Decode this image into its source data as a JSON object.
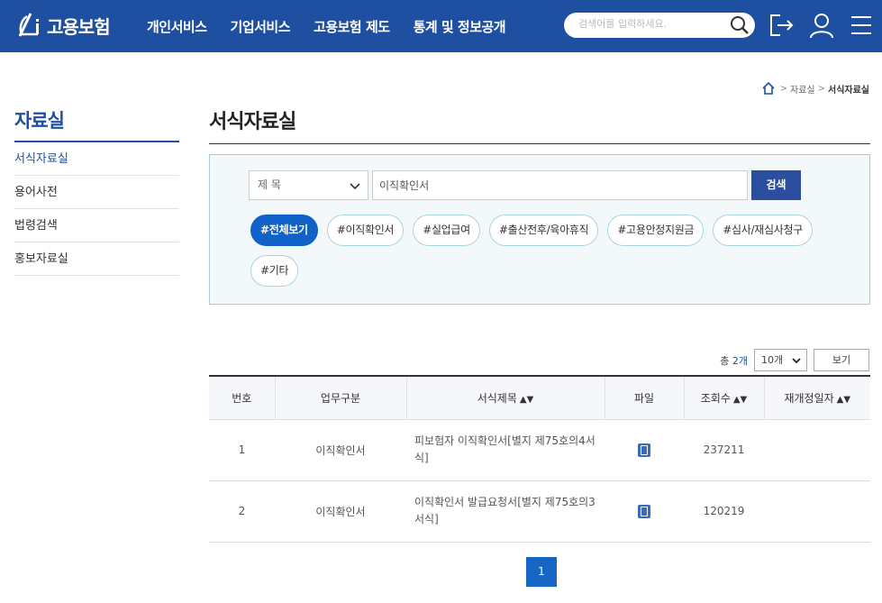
{
  "header": {
    "logo_mark": "ei",
    "logo_text": "고용보험",
    "nav": [
      "개인서비스",
      "기업서비스",
      "고용보험 제도",
      "통계 및 정보공개"
    ],
    "search_placeholder": "검색어를 입력하세요."
  },
  "breadcrumb": {
    "items": [
      "자료실",
      "서식자료실"
    ]
  },
  "sidebar": {
    "title": "자료실",
    "items": [
      {
        "label": "서식자료실",
        "active": true
      },
      {
        "label": "용어사전"
      },
      {
        "label": "법령검색"
      },
      {
        "label": "홍보자료실"
      }
    ]
  },
  "page_title": "서식자료실",
  "filter": {
    "select_value": "제 목",
    "keyword": "이직확인서",
    "search_label": "검색",
    "tags": [
      "#전체보기",
      "#이직확인서",
      "#실업급여",
      "#출산전후/육아휴직",
      "#고용안정지원금",
      "#심사/재심사청구",
      "#기타"
    ]
  },
  "list_info": {
    "total_prefix": "총",
    "total_count": "2개",
    "page_size": "10개",
    "view_label": "보기"
  },
  "table": {
    "headers": [
      "번호",
      "업무구분",
      "서식제목",
      "파일",
      "조회수",
      "재개정일자"
    ],
    "sort_glyph": "▲▼",
    "rows": [
      {
        "no": "1",
        "category": "이직확인서",
        "title": "피보험자 이직확인서[별지 제75호의4서식]",
        "views": "237211",
        "date": ""
      },
      {
        "no": "2",
        "category": "이직확인서",
        "title": "이직확인서 발급요청서[별지 제75호의3서식]",
        "views": "120219",
        "date": ""
      }
    ]
  },
  "pagination": {
    "current": "1"
  },
  "colors": {
    "brand": "#1f4fa0",
    "active_tag": "#1162c8",
    "search_button": "#2b4f9e",
    "filter_bg": "#f3f9fb"
  }
}
